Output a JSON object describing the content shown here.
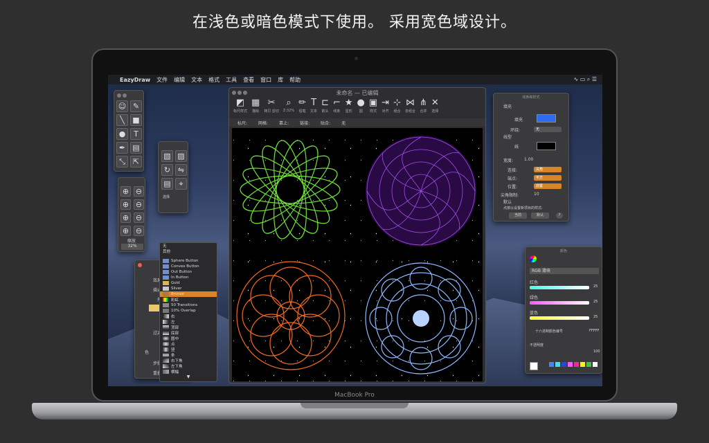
{
  "headline": "在浅色或暗色模式下使用。 采用宽色域设计。",
  "laptop_label": "MacBook Pro",
  "menubar": {
    "apple": "",
    "app": "EazyDraw",
    "items": [
      "文件",
      "编辑",
      "文本",
      "格式",
      "工具",
      "查看",
      "窗口",
      "库",
      "帮助"
    ],
    "status": "∿ ▭ ⌕ ☰"
  },
  "tools": [
    "☺",
    "✎",
    "╲",
    "■",
    "●",
    "T",
    "✒",
    "▤",
    "⤡",
    "⇱"
  ],
  "zoom_panel": {
    "label": "缩放",
    "value": "32%"
  },
  "select_panel": {
    "radio1": "选择",
    "radio2": "",
    "radio3": ""
  },
  "doc": {
    "title": "未命名 — 已编辑",
    "toolbar": [
      {
        "g": "◩",
        "l": "标尺样式"
      },
      {
        "g": "▦",
        "l": "描绘"
      },
      {
        "g": "✂",
        "l": "拷贝 剪切"
      },
      {
        "g": "⌕",
        "l": "Z:32%"
      },
      {
        "g": "✏",
        "l": "铅笔"
      },
      {
        "g": "T",
        "l": "文本"
      },
      {
        "g": "⊏",
        "l": "箭头"
      },
      {
        "g": "⌐",
        "l": "线条"
      },
      {
        "g": "★",
        "l": "星形"
      },
      {
        "g": "●",
        "l": "圆"
      },
      {
        "g": "▣",
        "l": "样式"
      },
      {
        "g": "⇥",
        "l": "对齐"
      },
      {
        "g": "⊹",
        "l": "组合"
      },
      {
        "g": "⋈",
        "l": "去组合"
      },
      {
        "g": "⋔",
        "l": "合并"
      },
      {
        "g": "✕",
        "l": "选择"
      }
    ],
    "options": [
      "标尺:",
      "网格:",
      "靠上:",
      "链接:",
      "贴合:",
      "无"
    ]
  },
  "inspector": {
    "title": "线条和样式",
    "fill": "填充",
    "fill_label": "填充",
    "loop": "环绕:",
    "loop_value": "无",
    "stroke": "线型",
    "stroke_label": "线",
    "width_label": "宽度:",
    "width_value": "1.00",
    "join_label": "连接:",
    "join_value": "尖角",
    "cap_label": "端点:",
    "cap_value": "平方",
    "pos_label": "位置:",
    "pos_value": "前置",
    "miter_label": "尖角限制:",
    "miter_value": "10",
    "default": "默认",
    "hint": "点按以设置新项目的样式:",
    "btn1": "当前",
    "btn2": "默认",
    "help": "?"
  },
  "colors": {
    "title": "颜色",
    "mode": "RGB 滑块",
    "red": "红色",
    "red_val": "25",
    "green": "绿色",
    "green_val": "25",
    "blue": "蓝色",
    "blue_val": "25",
    "hex_label": "十六进制颜色编号",
    "hex_val": "FFFFF",
    "opacity": "不透明度",
    "opacity_val": "100",
    "swatches": [
      "#3a88ff",
      "#44ddee",
      "#2244ff",
      "#ff55ff",
      "#ff2299",
      "#ffee22",
      "#33cc33",
      "#ffffff"
    ]
  },
  "menu": {
    "head1": "无",
    "head2": "其他",
    "items": [
      "Sphere Button",
      "Convex Button",
      "Out Button",
      "In Button",
      "Gold",
      "Silver",
      "Bronze",
      "彩虹",
      "50 Transitions",
      "10% Overlap",
      "右",
      "左",
      "顶部",
      "底部",
      "圆中",
      "点",
      "竖",
      "条",
      "右下角",
      "左下角",
      "横幅"
    ],
    "selected": "Bronze",
    "more": "▼"
  },
  "left_panel": {
    "rows": [
      "效果",
      "描述",
      "外",
      "过滤",
      "色",
      "步骤",
      "重叠"
    ]
  }
}
